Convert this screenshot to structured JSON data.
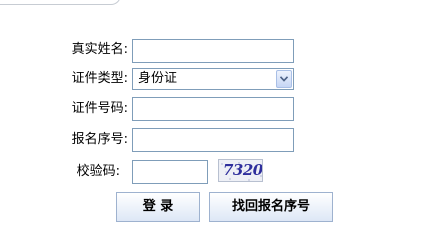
{
  "form": {
    "real_name_label": "真实姓名:",
    "real_name_value": "",
    "id_type_label": "证件类型:",
    "id_type_selected": "身份证",
    "id_number_label": "证件号码:",
    "id_number_value": "",
    "reg_number_label": "报名序号:",
    "reg_number_value": "",
    "captcha_label": "校验码:",
    "captcha_value": "",
    "captcha_text": "7320"
  },
  "buttons": {
    "login_label": "登 录",
    "recover_label": "找回报名序号"
  },
  "icons": {
    "dropdown": "chevron-down-icon"
  },
  "colors": {
    "input_border": "#7f9db9",
    "button_border": "#9eb2cf",
    "captcha_text": "#2e2e9c"
  }
}
